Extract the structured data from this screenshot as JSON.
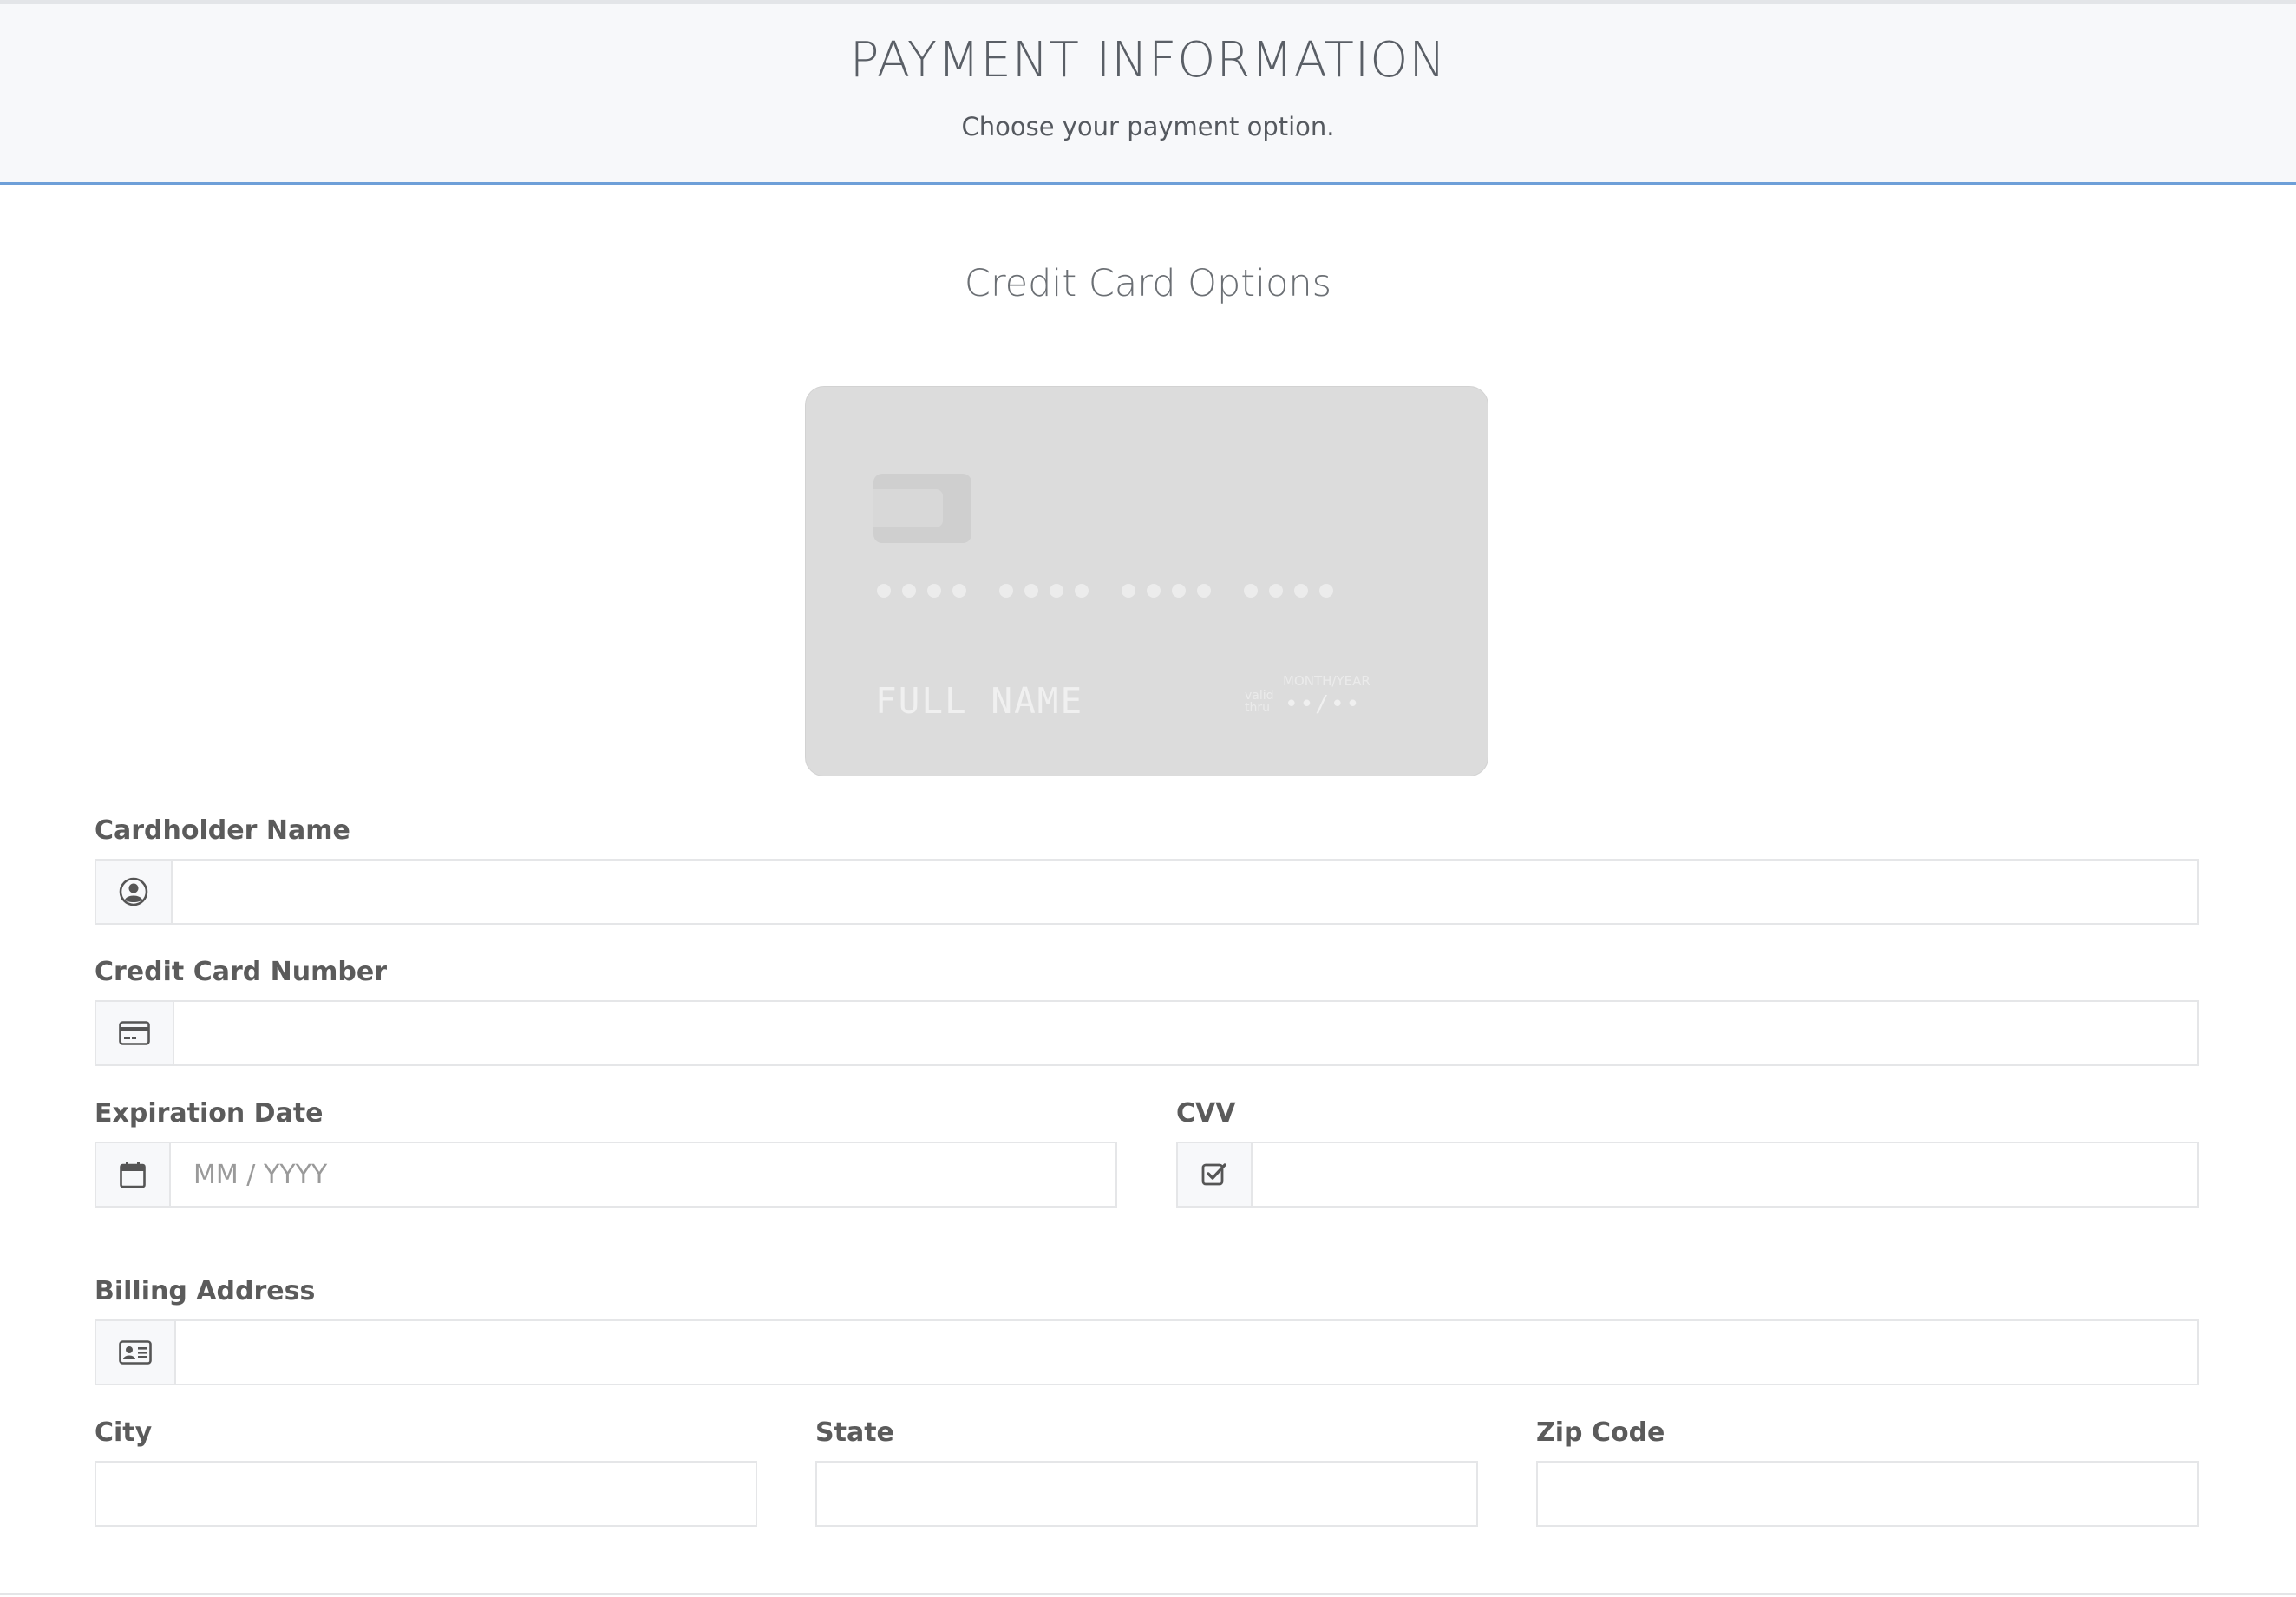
{
  "header": {
    "title": "PAYMENT INFORMATION",
    "subtitle": "Choose your payment option."
  },
  "section": {
    "title": "Credit Card Options"
  },
  "card_preview": {
    "number_mask": "•••• •••• •••• ••••",
    "name_placeholder": "FULL NAME",
    "valid_label_line1": "valid",
    "valid_label_line2": "thru",
    "expiry_label": "MONTH/YEAR",
    "expiry_mask": "••/••",
    "color": "#dcdcdc"
  },
  "form": {
    "cardholder_name": {
      "label": "Cardholder Name",
      "icon": "user-circle-icon",
      "value": "",
      "placeholder": ""
    },
    "card_number": {
      "label": "Credit Card Number",
      "icon": "credit-card-icon",
      "value": "",
      "placeholder": ""
    },
    "expiration_date": {
      "label": "Expiration Date",
      "icon": "calendar-icon",
      "value": "",
      "placeholder": "MM / YYYY"
    },
    "cvv": {
      "label": "CVV",
      "icon": "check-square-icon",
      "value": "",
      "placeholder": ""
    },
    "billing_address": {
      "label": "Billing Address",
      "icon": "address-card-icon",
      "value": "",
      "placeholder": ""
    },
    "city": {
      "label": "City",
      "value": ""
    },
    "state": {
      "label": "State",
      "value": ""
    },
    "zip_code": {
      "label": "Zip Code",
      "value": ""
    }
  },
  "colors": {
    "header_bg": "#f7f8fa",
    "header_border_accent": "#6e9fd8",
    "label_text": "#5b5b5b",
    "input_border": "#e5e6e8"
  }
}
